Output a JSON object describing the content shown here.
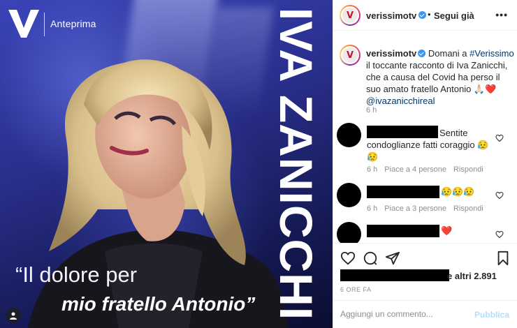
{
  "media": {
    "logo_text": "Anteprima",
    "vertical_name": "IVA ZANICCHI",
    "quote_line1": "“Il dolore per",
    "quote_line2": "mio fratello Antonio”"
  },
  "header": {
    "username": "verissimotv",
    "separator": "•",
    "follow_label": "Segui già",
    "more_label": "•••"
  },
  "caption": {
    "username": "verissimotv",
    "text_before": " Domani a ",
    "hashtag": "#Verissimo",
    "text_after": " il toccante racconto di Iva Zanicchi, che a causa del Covid ha perso il suo amato fratello Antonio 🙏🏻❤️",
    "mention": "@ivazanicchireal",
    "time": "6 h"
  },
  "comments": [
    {
      "text": "Sentite condoglianze fatti coraggio 😥😥",
      "time": "6 h",
      "likes": "Piace a 4 persone",
      "reply": "Rispondi"
    },
    {
      "text": "😥😥😥",
      "time": "6 h",
      "likes": "Piace a 3 persone",
      "reply": "Rispondi"
    },
    {
      "text": "❤️"
    }
  ],
  "likes": {
    "text": "e altri 2.891"
  },
  "post_time": "6 ORE FA",
  "add_comment": {
    "placeholder": "Aggiungi un commento...",
    "publish_label": "Pubblica"
  },
  "colors": {
    "link": "#00376b",
    "publish_disabled": "#b2dffc",
    "verified_badge": "#3897f0",
    "heart": "#ed4956"
  }
}
